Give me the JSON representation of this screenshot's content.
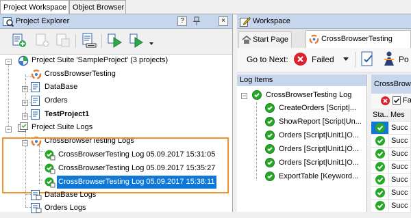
{
  "workspace_tabs": [
    "Project Workspace",
    "Object Browser"
  ],
  "project_explorer": {
    "title": "Project Explorer",
    "help_button": "?",
    "tree": {
      "suite": "Project Suite 'SampleProject' (3 projects)",
      "projects": [
        "CrossBrowserTesting",
        "DataBase",
        "Orders",
        "TestProject1"
      ],
      "suite_logs": "Project Suite Logs",
      "cbt_logs": "CrossBrowserTesting Logs",
      "log_entries": [
        "CrossBrowserTesting Log 05.09.2017 15:31:05",
        "CrossBrowserTesting Log 05.09.2017 15:35:27",
        "CrossBrowserTesting Log 05.09.2017 15:38:11"
      ],
      "other_logs": [
        "DataBase Logs",
        "Orders Logs"
      ]
    }
  },
  "workspace": {
    "title": "Workspace",
    "tabs": [
      "Start Page",
      "CrossBrowserTesting"
    ],
    "go_to_next_label": "Go to Next:",
    "go_to_next_value": "Failed",
    "po_label": "Po"
  },
  "log_items": {
    "title": "Log Items",
    "root": "CrossBrowserTesting Log",
    "children": [
      "CreateOrders [Script|...",
      "ShowReport [Script|Un...",
      "Orders [Script|Unit1|O...",
      "Orders [Script|Unit1|O...",
      "Orders [Script|Unit1|O...",
      "ExportTable [Keyword..."
    ]
  },
  "details": {
    "title": "CrossBrowse",
    "filter_label": "Fa",
    "columns": [
      "Sta...",
      "Mes"
    ],
    "rows": [
      "Succ",
      "Succ",
      "Succ",
      "Succ",
      "Succ",
      "Succ",
      "Succ"
    ]
  },
  "colors": {
    "header_bg": "#c6d6ec",
    "selection": "#0f78d7",
    "highlight_border": "#f0932b",
    "success_green": "#26a826",
    "error_red": "#d9232e"
  }
}
